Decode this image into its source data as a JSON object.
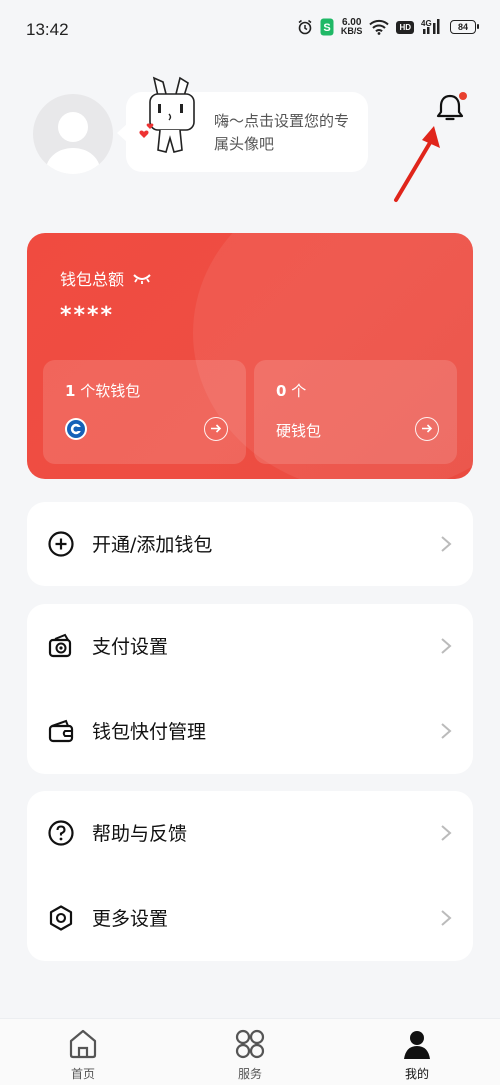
{
  "status_bar": {
    "time": "13:42",
    "net_speed_value": "6.00",
    "net_speed_unit": "KB/S",
    "hd_badge": "HD",
    "network": "4G",
    "battery": "84"
  },
  "profile": {
    "tip": "嗨～点击设置您的专属头像吧"
  },
  "wallet_card": {
    "title": "钱包总额",
    "amount": "****",
    "soft_wallet_count": "1",
    "soft_wallet_label": "个软钱包",
    "hard_wallet_count": "0",
    "hard_wallet_unit": "个",
    "hard_wallet_label": "硬钱包"
  },
  "menu": {
    "open_add_wallet": "开通/添加钱包",
    "payment_settings": "支付设置",
    "quick_pay_management": "钱包快付管理",
    "help_feedback": "帮助与反馈",
    "more_settings": "更多设置"
  },
  "tabs": {
    "home": "首页",
    "services": "服务",
    "mine": "我的"
  },
  "colors": {
    "accent": "#ef4c41",
    "notification_dot": "#e8402f",
    "annotation_arrow": "#e0251b"
  }
}
